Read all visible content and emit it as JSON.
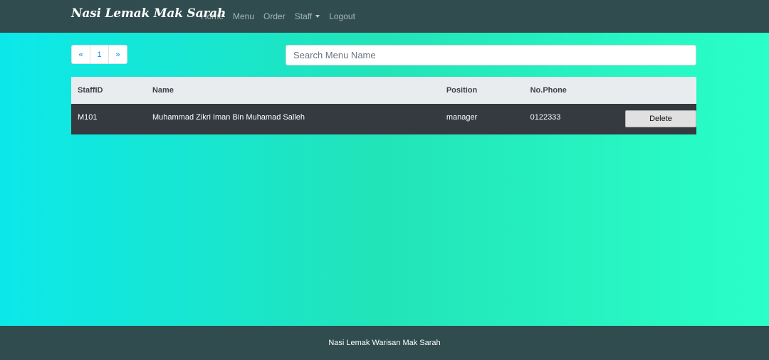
{
  "navbar": {
    "brand": "Nasi Lemak Mak Sarah",
    "links": {
      "home": "Home",
      "menu": "Menu",
      "order": "Order",
      "staff": "Staff",
      "logout": "Logout"
    }
  },
  "pagination": {
    "prev": "«",
    "page": "1",
    "next": "»"
  },
  "search": {
    "placeholder": "Search Menu Name",
    "value": ""
  },
  "table": {
    "headers": {
      "staff_id": "StaffID",
      "name": "Name",
      "position": "Position",
      "phone": "No.Phone"
    },
    "rows": [
      {
        "staff_id": "M101",
        "name": "Muhammad Zikri Iman Bin Muhamad Salleh",
        "position": "manager",
        "phone": "0122333",
        "action": "Delete"
      }
    ]
  },
  "footer": {
    "text": "Nasi Lemak Warisan Mak Sarah"
  },
  "colors": {
    "navbar_bg": "#304c4e",
    "gradient_left": "#0ce8ea",
    "gradient_mid": "#22e4b8",
    "gradient_right": "#2affc8",
    "table_header_bg": "#e9ecef",
    "table_row_bg": "#343a40",
    "link_accent": "#0d8bf0"
  },
  "icons": {
    "staff_dropdown": "caret-down-icon"
  }
}
